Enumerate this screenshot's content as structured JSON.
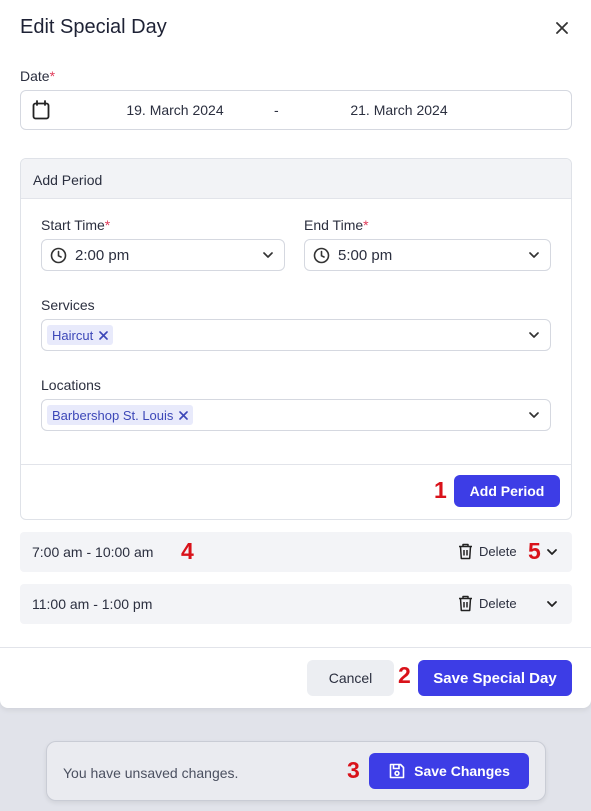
{
  "modal": {
    "title": "Edit Special Day"
  },
  "date": {
    "label": "Date",
    "required_mark": "*",
    "start": "19. March 2024",
    "separator": "-",
    "end": "21. March 2024"
  },
  "add_period": {
    "title": "Add Period",
    "start_time": {
      "label": "Start Time",
      "required_mark": "*",
      "value": "2:00 pm"
    },
    "end_time": {
      "label": "End Time",
      "required_mark": "*",
      "value": "5:00 pm"
    },
    "services": {
      "label": "Services",
      "tags": [
        "Haircut"
      ]
    },
    "locations": {
      "label": "Locations",
      "tags": [
        "Barbershop St. Louis"
      ]
    },
    "button_label": "Add Period"
  },
  "periods": [
    {
      "time": "7:00 am - 10:00 am",
      "delete_label": "Delete"
    },
    {
      "time": "11:00 am - 1:00 pm",
      "delete_label": "Delete"
    }
  ],
  "footer": {
    "cancel_label": "Cancel",
    "save_label": "Save Special Day"
  },
  "unsaved_bar": {
    "message": "You have unsaved changes.",
    "save_label": "Save Changes"
  },
  "annotations": [
    "1",
    "2",
    "3",
    "4",
    "5"
  ],
  "colors": {
    "primary": "#3d3de6",
    "required": "#e03c5a",
    "tag_bg": "#e8eafb",
    "tag_text": "#3c47b8",
    "annotation": "#d9121a",
    "backdrop": "#e1e3ea"
  },
  "icons": [
    "close-icon",
    "calendar-icon",
    "clock-icon",
    "chevron-down-icon",
    "tag-remove-icon",
    "trash-icon",
    "save-icon"
  ]
}
